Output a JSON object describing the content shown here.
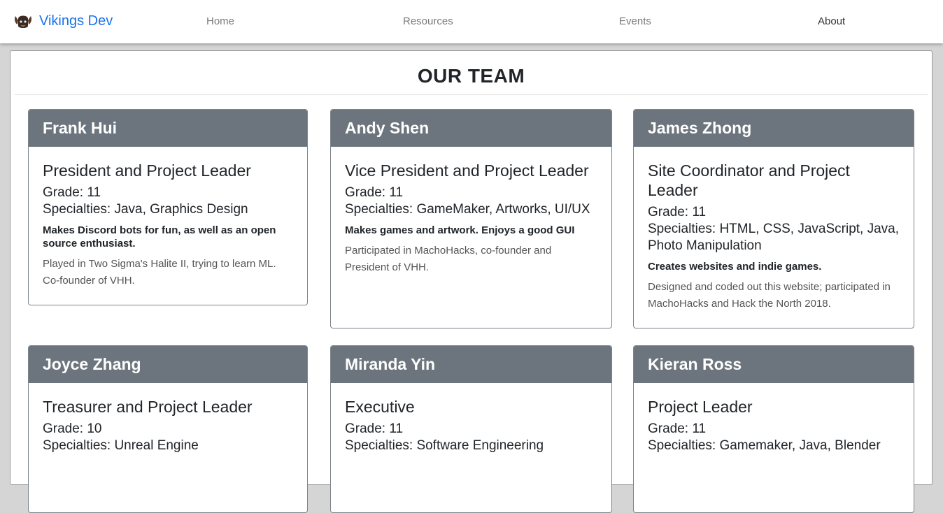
{
  "brand": {
    "name": "Vikings Dev"
  },
  "nav": [
    {
      "label": "Home"
    },
    {
      "label": "Resources"
    },
    {
      "label": "Events"
    },
    {
      "label": "About"
    }
  ],
  "page": {
    "title": "OUR TEAM"
  },
  "members": [
    {
      "name": "Frank Hui",
      "role": "President and Project Leader",
      "grade": "Grade: 11",
      "specialties": "Specialties: Java, Graphics Design",
      "description": "Makes Discord bots for fun, as well as an open source enthusiast.",
      "note": "Played in Two Sigma's Halite II, trying to learn ML. Co-founder of VHH."
    },
    {
      "name": "Andy Shen",
      "role": "Vice President and Project Leader",
      "grade": "Grade: 11",
      "specialties": "Specialties: GameMaker, Artworks, UI/UX",
      "description": "Makes games and artwork. Enjoys a good GUI",
      "note": "Participated in MachoHacks, co-founder and President of VHH."
    },
    {
      "name": "James Zhong",
      "role": "Site Coordinator and Project Leader",
      "grade": "Grade: 11",
      "specialties": "Specialties: HTML, CSS, JavaScript, Java, Photo Manipulation",
      "description": "Creates websites and indie games.",
      "note": "Designed and coded out this website; participated in MachoHacks and Hack the North 2018."
    },
    {
      "name": "Joyce Zhang",
      "role": "Treasurer and Project Leader",
      "grade": "Grade: 10",
      "specialties": "Specialties: Unreal Engine"
    },
    {
      "name": "Miranda Yin",
      "role": "Executive",
      "grade": "Grade: 11",
      "specialties": "Specialties: Software Engineering"
    },
    {
      "name": "Kieran Ross",
      "role": "Project Leader",
      "grade": "Grade: 11",
      "specialties": "Specialties: Gamemaker, Java, Blender"
    }
  ]
}
